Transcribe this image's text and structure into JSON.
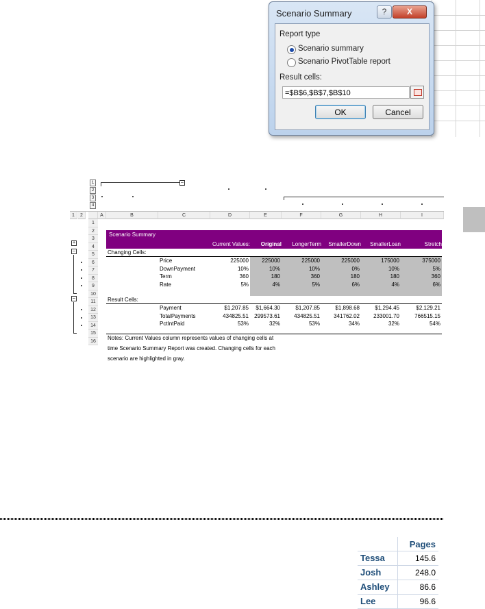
{
  "dialog": {
    "title": "Scenario Summary",
    "help_glyph": "?",
    "close_glyph": "X",
    "report_type_label": "Report type",
    "option_summary": "Scenario summary",
    "option_pivot": "Scenario PivotTable report",
    "result_cells_label": "Result cells:",
    "result_cells_value": "=$B$6,$B$7,$B$10",
    "ok_label": "OK",
    "cancel_label": "Cancel"
  },
  "sheet": {
    "level_buttons_top": [
      "1",
      "2",
      "3",
      "4"
    ],
    "level_buttons_left": [
      "1",
      "2"
    ],
    "collapse_glyph": "–",
    "expand_glyph": "+",
    "columns": [
      "A",
      "B",
      "C",
      "D",
      "E",
      "F",
      "G",
      "H",
      "I"
    ],
    "row_numbers": [
      "1",
      "2",
      "3",
      "4",
      "5",
      "6",
      "7",
      "8",
      "9",
      "10",
      "11",
      "12",
      "13",
      "14",
      "15",
      "16"
    ],
    "banner_title": "Scenario Summary",
    "header_cols": [
      "Current Values:",
      "Original",
      "LongerTerm",
      "SmallerDown",
      "SmallerLoan",
      "Stretch"
    ],
    "changing_cells_label": "Changing Cells:",
    "result_cells_label": "Result Cells:",
    "changing_rows": [
      {
        "name": "Price",
        "values": [
          "225000",
          "225000",
          "225000",
          "225000",
          "175000",
          "375000"
        ]
      },
      {
        "name": "DownPayment",
        "values": [
          "10%",
          "10%",
          "10%",
          "0%",
          "10%",
          "5%"
        ]
      },
      {
        "name": "Term",
        "values": [
          "360",
          "180",
          "360",
          "180",
          "180",
          "360"
        ]
      },
      {
        "name": "Rate",
        "values": [
          "5%",
          "4%",
          "5%",
          "6%",
          "4%",
          "6%"
        ]
      }
    ],
    "result_rows": [
      {
        "name": "Payment",
        "values": [
          "$1,207.85",
          "$1,664.30",
          "$1,207.85",
          "$1,898.68",
          "$1,294.45",
          "$2,129.21"
        ]
      },
      {
        "name": "TotalPayments",
        "values": [
          "434825.51",
          "299573.61",
          "434825.51",
          "341762.02",
          "233001.70",
          "766515.15"
        ]
      },
      {
        "name": "PctIntPaid",
        "values": [
          "53%",
          "32%",
          "53%",
          "34%",
          "32%",
          "54%"
        ]
      }
    ],
    "notes": [
      "Notes:  Current Values column represents values of changing cells at",
      "time Scenario Summary Report was created.  Changing cells for each",
      "scenario are highlighted in gray."
    ]
  },
  "pages_table": {
    "header": "Pages",
    "rows": [
      {
        "name": "Tessa",
        "value": "145.6"
      },
      {
        "name": "Josh",
        "value": "248.0"
      },
      {
        "name": "Ashley",
        "value": "86.6"
      },
      {
        "name": "Lee",
        "value": "96.6"
      }
    ]
  }
}
